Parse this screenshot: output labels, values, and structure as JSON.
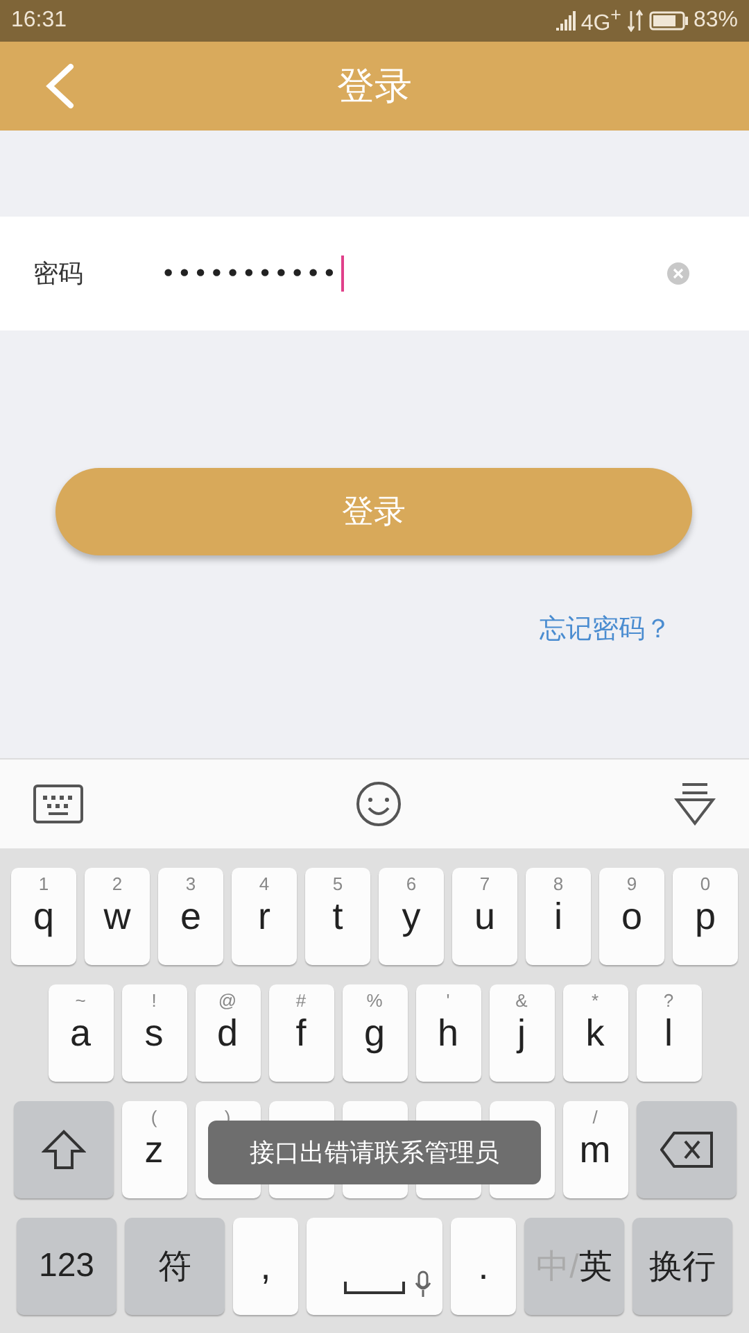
{
  "status_bar": {
    "time": "16:31",
    "network": "4G$^{+}$",
    "battery": "83%"
  },
  "header": {
    "title": "登录"
  },
  "password_field": {
    "label": "密码",
    "value": "•••••••••••"
  },
  "login_button": "登录",
  "forgot_link": "忘记密码？",
  "keyboard": {
    "rows": [
      {
        "keys": [
          {
            "kind": "letter",
            "hint": "1",
            "label": "q"
          },
          {
            "kind": "letter",
            "hint": "2",
            "label": "w"
          },
          {
            "kind": "letter",
            "hint": "3",
            "label": "e"
          },
          {
            "kind": "letter",
            "hint": "4",
            "label": "r"
          },
          {
            "kind": "letter",
            "hint": "5",
            "label": "t"
          },
          {
            "kind": "letter",
            "hint": "6",
            "label": "y"
          },
          {
            "kind": "letter",
            "hint": "7",
            "label": "u"
          },
          {
            "kind": "letter",
            "hint": "8",
            "label": "i"
          },
          {
            "kind": "letter",
            "hint": "9",
            "label": "o"
          },
          {
            "kind": "letter",
            "hint": "0",
            "label": "p"
          }
        ]
      },
      {
        "keys": [
          {
            "kind": "letter",
            "hint": "~",
            "label": "a"
          },
          {
            "kind": "letter",
            "hint": "!",
            "label": "s"
          },
          {
            "kind": "letter",
            "hint": "@",
            "label": "d"
          },
          {
            "kind": "letter",
            "hint": "#",
            "label": "f"
          },
          {
            "kind": "letter",
            "hint": "%",
            "label": "g"
          },
          {
            "kind": "letter",
            "hint": "'",
            "label": "h"
          },
          {
            "kind": "letter",
            "hint": "&",
            "label": "j"
          },
          {
            "kind": "letter",
            "hint": "*",
            "label": "k"
          },
          {
            "kind": "letter",
            "hint": "?",
            "label": "l"
          }
        ]
      },
      {
        "keys": [
          {
            "kind": "shift"
          },
          {
            "kind": "letter",
            "hint": "(",
            "label": "z"
          },
          {
            "kind": "letter",
            "hint": ")"
          },
          {
            "kind": "letter"
          },
          {
            "kind": "letter"
          },
          {
            "kind": "letter"
          },
          {
            "kind": "letter"
          },
          {
            "kind": "letter",
            "hint": "/",
            "label": "m"
          },
          {
            "kind": "delete"
          }
        ]
      },
      {
        "keys": [
          {
            "kind": "func",
            "label": "123"
          },
          {
            "kind": "func",
            "label": "符"
          },
          {
            "kind": "letter",
            "label": ","
          },
          {
            "kind": "space"
          },
          {
            "kind": "letter",
            "label": "."
          },
          {
            "kind": "lang",
            "dim": "中/",
            "label": "英"
          },
          {
            "kind": "func",
            "label": "换行"
          }
        ]
      }
    ]
  },
  "toast": "接口出错请联系管理员"
}
